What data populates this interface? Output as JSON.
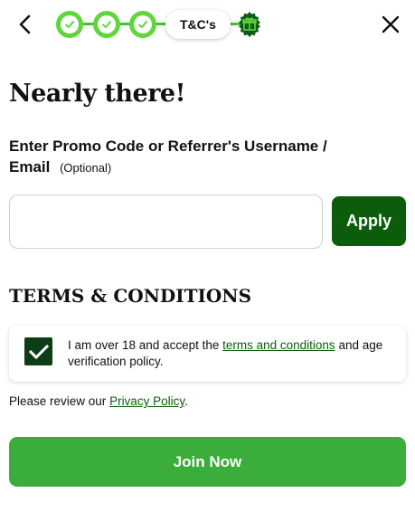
{
  "header": {
    "back_icon": "chevron-left-icon",
    "close_icon": "close-icon",
    "stepper": {
      "completed_steps": 3,
      "current_step_label": "T&C's",
      "final_step_icon": "gift-icon"
    }
  },
  "colors": {
    "step_green": "#5fd63a",
    "dark_green": "#0b5d0b",
    "checkbox_green": "#0d3d14",
    "join_green": "#3aad3a"
  },
  "main": {
    "title": "Nearly there!",
    "promo": {
      "label": "Enter Promo Code or Referrer's Username / Email",
      "optional": "(Optional)",
      "input_value": "",
      "input_placeholder": "",
      "apply_label": "Apply"
    },
    "terms": {
      "heading": "TERMS & CONDITIONS",
      "checkbox_checked": true,
      "text_before": "I am over 18 and accept the ",
      "link_text": "terms and conditions",
      "text_after": " and age verification policy."
    },
    "privacy": {
      "text_before": "Please review our ",
      "link_text": "Privacy Policy",
      "text_after": "."
    },
    "join_label": "Join Now"
  }
}
